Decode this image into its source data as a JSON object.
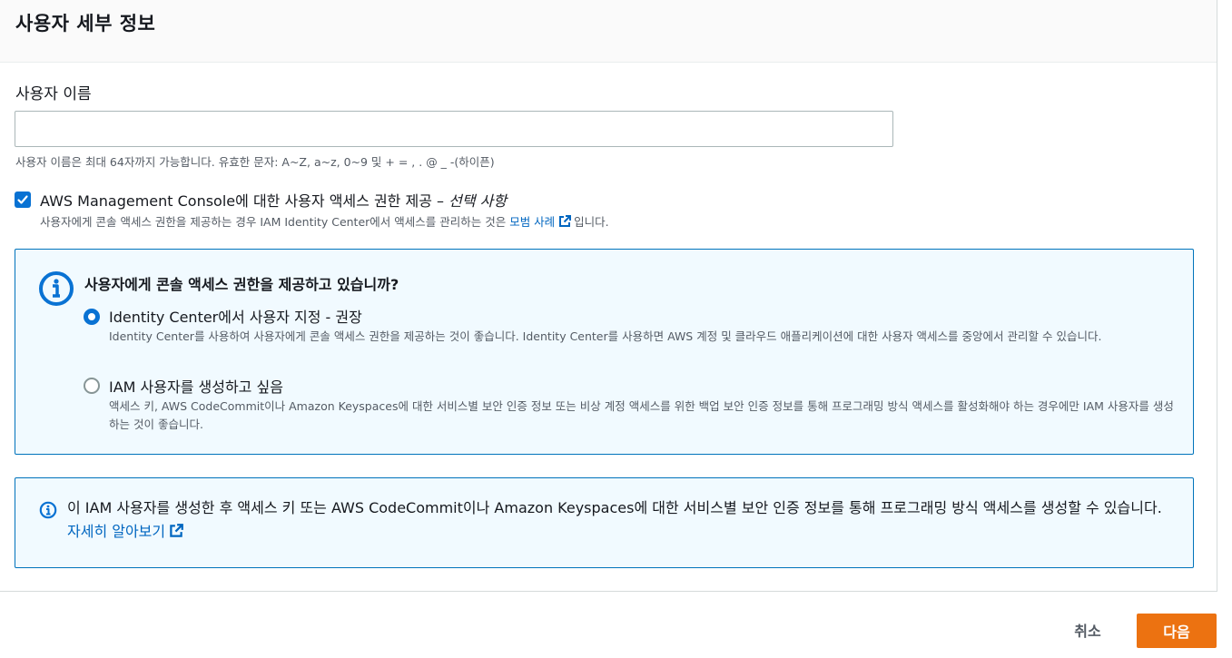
{
  "panel": {
    "title": "사용자 세부 정보"
  },
  "username": {
    "label": "사용자 이름",
    "value": "",
    "placeholder": "",
    "hint": "사용자 이름은 최대 64자까지 가능합니다. 유효한 문자: A~Z, a~z, 0~9 및 + = , . @ _ -(하이픈)"
  },
  "console_access": {
    "checked": true,
    "label": "AWS Management Console에 대한 사용자 액세스 권한 제공 –",
    "optional": "선택 사항",
    "desc_before": "사용자에게 콘솔 액세스 권한을 제공하는 경우 IAM Identity Center에서 액세스를 관리하는 것은 ",
    "desc_link": "모범 사례",
    "desc_after": "입니다."
  },
  "access_question": {
    "title": "사용자에게 콘솔 액세스 권한을 제공하고 있습니까?",
    "options": [
      {
        "label": "Identity Center에서 사용자 지정 - 권장",
        "selected": true,
        "desc": "Identity Center를 사용하여 사용자에게 콘솔 액세스 권한을 제공하는 것이 좋습니다. Identity Center를 사용하면 AWS 계정 및 클라우드 애플리케이션에 대한 사용자 액세스를 중앙에서 관리할 수 있습니다."
      },
      {
        "label": "IAM 사용자를 생성하고 싶음",
        "selected": false,
        "desc": "액세스 키, AWS CodeCommit이나 Amazon Keyspaces에 대한 서비스별 보안 인증 정보 또는 비상 계정 액세스를 위한 백업 보안 인증 정보를 통해 프로그래밍 방식 액세스를 활성화해야 하는 경우에만 IAM 사용자를 생성하는 것이 좋습니다."
      }
    ]
  },
  "notice": {
    "text": "이 IAM 사용자를 생성한 후 액세스 키 또는 AWS CodeCommit이나 Amazon Keyspaces에 대한 서비스별 보안 인증 정보를 통해 프로그래밍 방식 액세스를 생성할 수 있습니다. ",
    "link": "자세히 알아보기"
  },
  "footer": {
    "cancel_label": "취소",
    "next_label": "다음"
  },
  "icons": {
    "checkbox": "check-icon",
    "info": "info-icon",
    "external": "external-link-icon"
  },
  "colors": {
    "primary_blue": "#0972d3",
    "link_blue": "#0066c0",
    "info_bg": "#f1faff",
    "info_border": "#0073bb",
    "next_button": "#ec7211"
  }
}
